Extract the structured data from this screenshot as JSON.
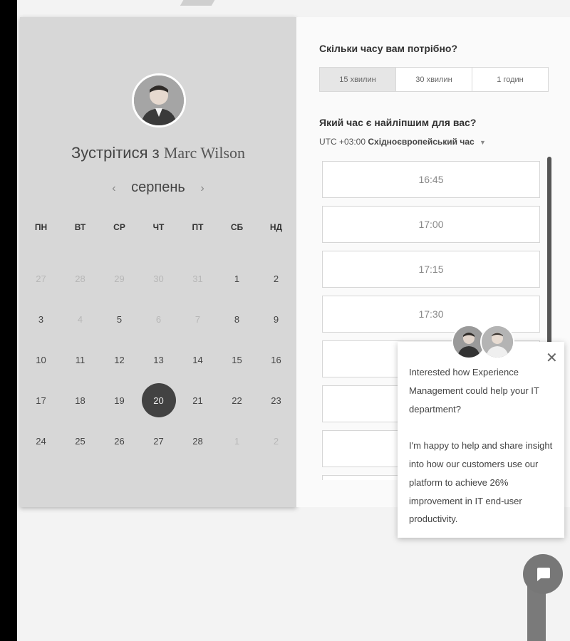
{
  "calendar": {
    "meet_prefix": "Зустрітися з",
    "meet_name": "Marc Wilson",
    "month": "серпень",
    "prev_arrow": "‹",
    "next_arrow": "›",
    "weekdays": [
      "ПН",
      "ВТ",
      "СР",
      "ЧТ",
      "ПТ",
      "СБ",
      "НД"
    ],
    "weeks": [
      [
        "27",
        "28",
        "29",
        "30",
        "31",
        "1",
        "2"
      ],
      [
        "3",
        "4",
        "5",
        "6",
        "7",
        "8",
        "9"
      ],
      [
        "10",
        "11",
        "12",
        "13",
        "14",
        "15",
        "16"
      ],
      [
        "17",
        "18",
        "19",
        "20",
        "21",
        "22",
        "23"
      ],
      [
        "24",
        "25",
        "26",
        "27",
        "28",
        "1",
        "2"
      ]
    ],
    "selected_day": "20"
  },
  "duration": {
    "question": "Скільки часу вам потрібно?",
    "options": [
      "15 хвилин",
      "30 хвилин",
      "1 годин"
    ]
  },
  "time": {
    "question": "Який час є найліпшим для вас?",
    "tz_offset": "UTC +03:00",
    "tz_name": "Східноєвропейський час",
    "tz_caret": "▼",
    "slots": [
      "16:45",
      "17:00",
      "17:15",
      "17:30",
      "",
      "",
      ""
    ]
  },
  "chat": {
    "close": "✕",
    "message": "Interested how Experience Management could help your IT department?\n\nI'm happy to help and share insight into how our customers use our platform to achieve 26% improvement in IT end-user productivity."
  }
}
